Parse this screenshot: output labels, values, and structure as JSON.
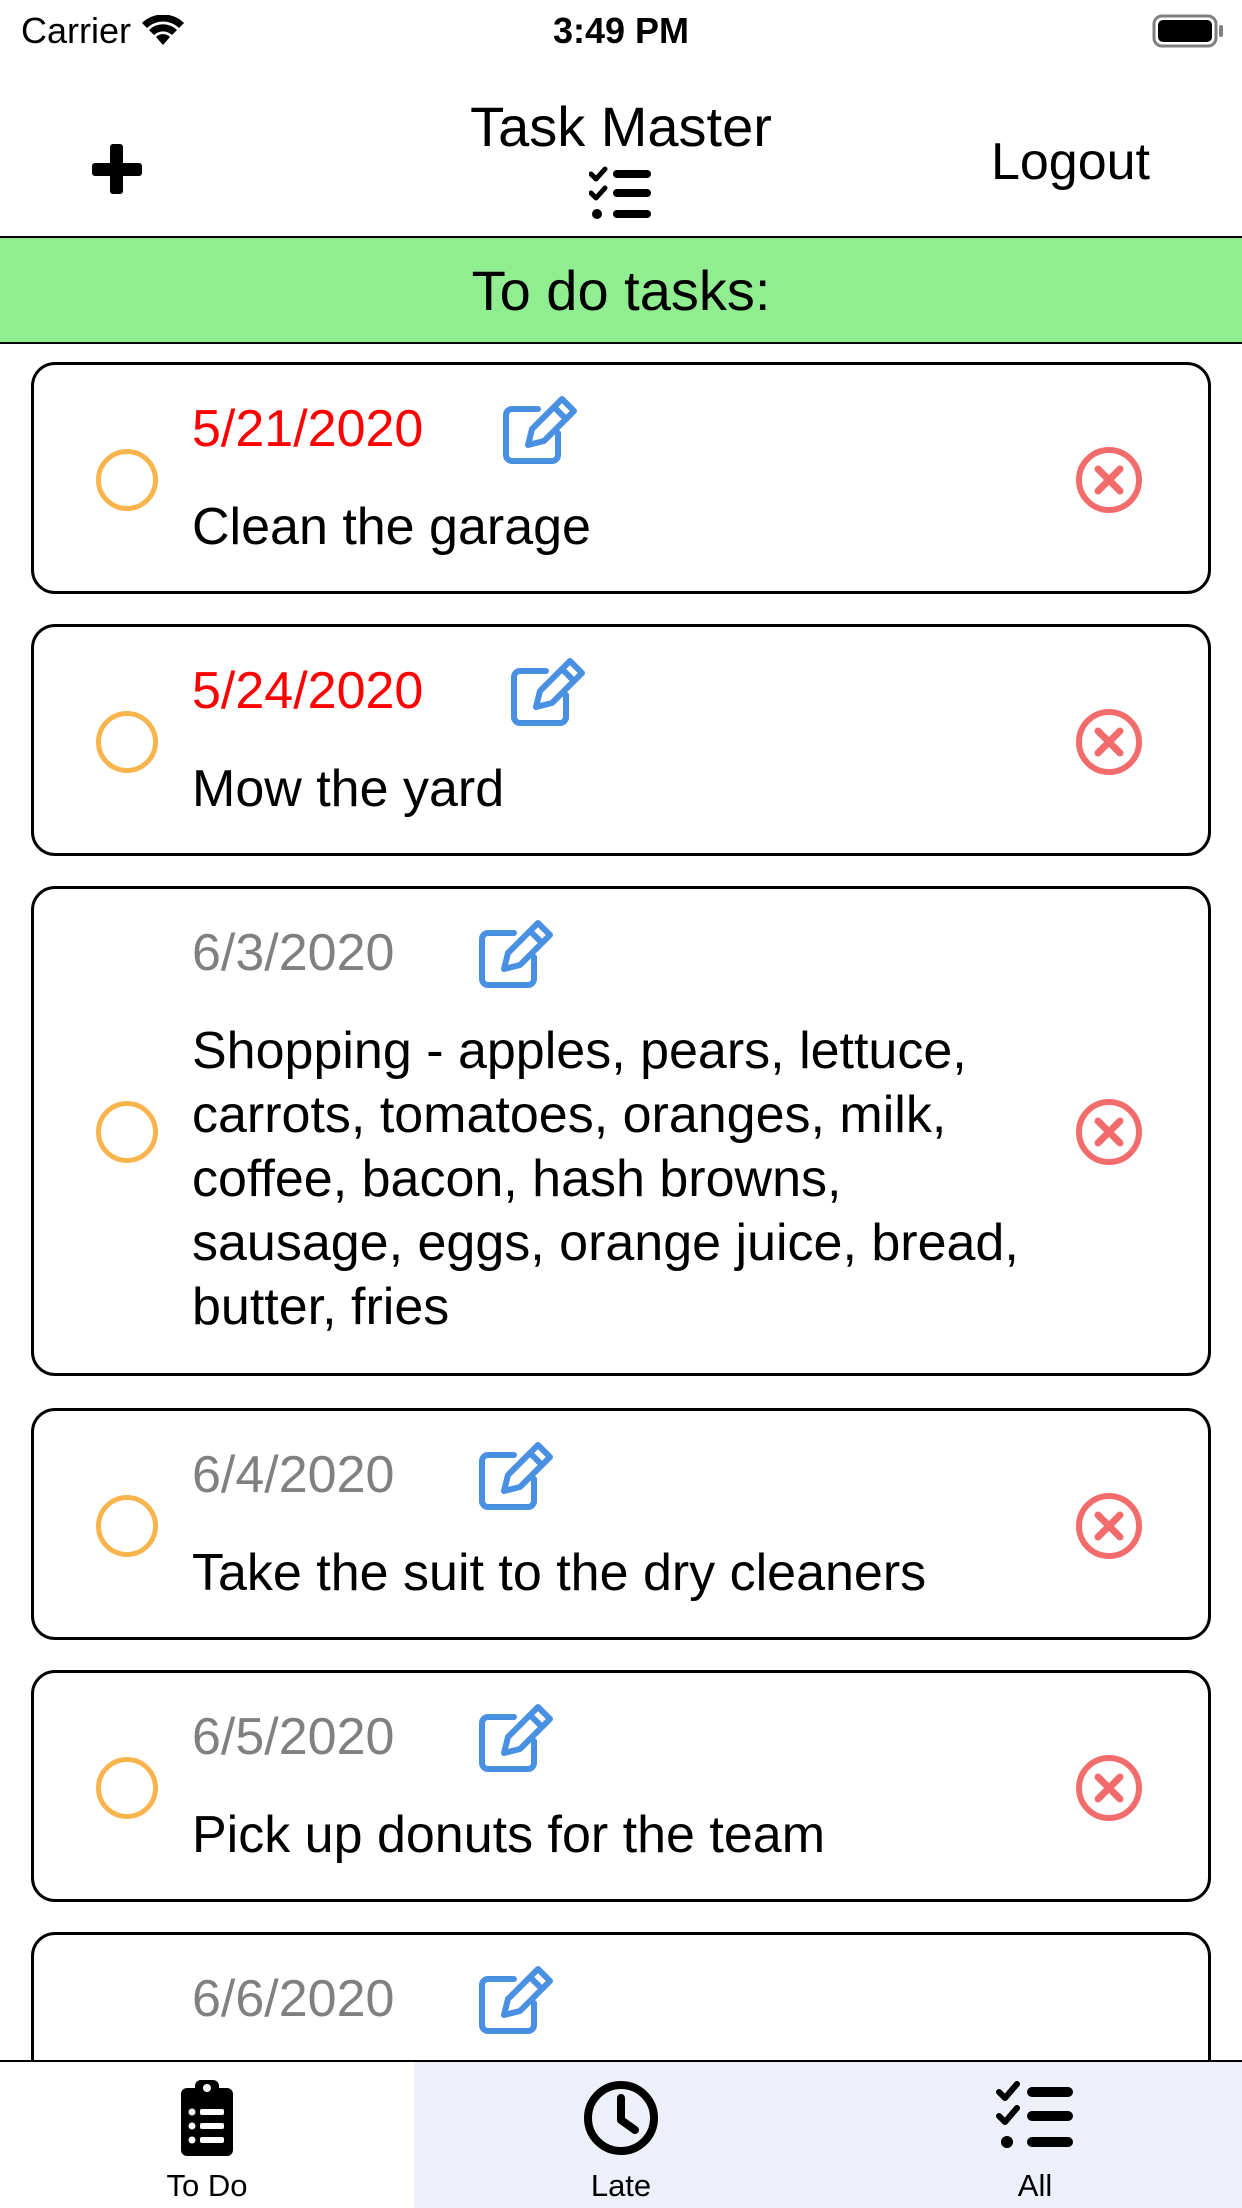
{
  "status_bar": {
    "carrier": "Carrier",
    "time": "3:49 PM"
  },
  "nav": {
    "title": "Task Master",
    "logout_label": "Logout"
  },
  "section": {
    "title": "To do tasks:"
  },
  "colors": {
    "late_date": "#ff0000",
    "upcoming_date": "#808080",
    "header_bg": "#90ee90",
    "complete_circle": "#f9b44e",
    "edit_icon": "#4a90e2",
    "delete_icon": "#f36c6c"
  },
  "tasks": [
    {
      "date": "5/21/2020",
      "status": "late",
      "description": "Clean the garage"
    },
    {
      "date": "5/24/2020",
      "status": "late",
      "description": "Mow the yard"
    },
    {
      "date": "6/3/2020",
      "status": "upcoming",
      "description": "Shopping - apples, pears, lettuce, carrots, tomatoes, oranges, milk, coffee, bacon, hash browns, sausage, eggs, orange juice, bread, butter, fries"
    },
    {
      "date": "6/4/2020",
      "status": "upcoming",
      "description": "Take the suit to the dry cleaners"
    },
    {
      "date": "6/5/2020",
      "status": "upcoming",
      "description": "Pick up donuts for the team"
    },
    {
      "date": "6/6/2020",
      "status": "upcoming",
      "description": ""
    }
  ],
  "tabs": [
    {
      "label": "To Do",
      "icon": "clipboard-list-icon",
      "selected": true
    },
    {
      "label": "Late",
      "icon": "clock-icon",
      "selected": false
    },
    {
      "label": "All",
      "icon": "checklist-icon",
      "selected": false
    }
  ]
}
